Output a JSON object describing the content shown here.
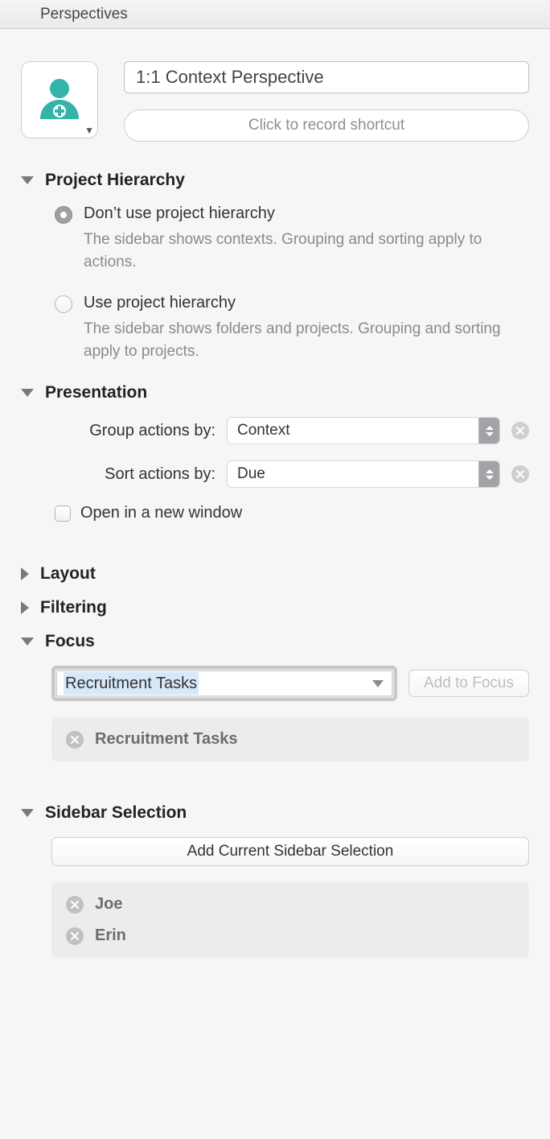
{
  "window": {
    "title": "Perspectives"
  },
  "header": {
    "name": "1:1 Context Perspective",
    "record_placeholder": "Click to record shortcut"
  },
  "project_hierarchy": {
    "title": "Project Hierarchy",
    "options": [
      {
        "label": "Don’t use project hierarchy",
        "desc": "The sidebar shows contexts. Grouping and sorting apply to actions.",
        "selected": true
      },
      {
        "label": "Use project hierarchy",
        "desc": "The sidebar shows folders and projects. Grouping and sorting apply to projects.",
        "selected": false
      }
    ]
  },
  "presentation": {
    "title": "Presentation",
    "group_label": "Group actions by:",
    "group_value": "Context",
    "sort_label": "Sort actions by:",
    "sort_value": "Due",
    "open_new_window": "Open in a new window",
    "open_new_window_checked": false
  },
  "layout": {
    "title": "Layout"
  },
  "filtering": {
    "title": "Filtering"
  },
  "focus": {
    "title": "Focus",
    "combo_value": "Recruitment Tasks",
    "add_btn": "Add to Focus",
    "items": [
      "Recruitment Tasks"
    ]
  },
  "sidebar_selection": {
    "title": "Sidebar Selection",
    "add_btn": "Add Current Sidebar Selection",
    "items": [
      "Joe",
      "Erin"
    ]
  }
}
